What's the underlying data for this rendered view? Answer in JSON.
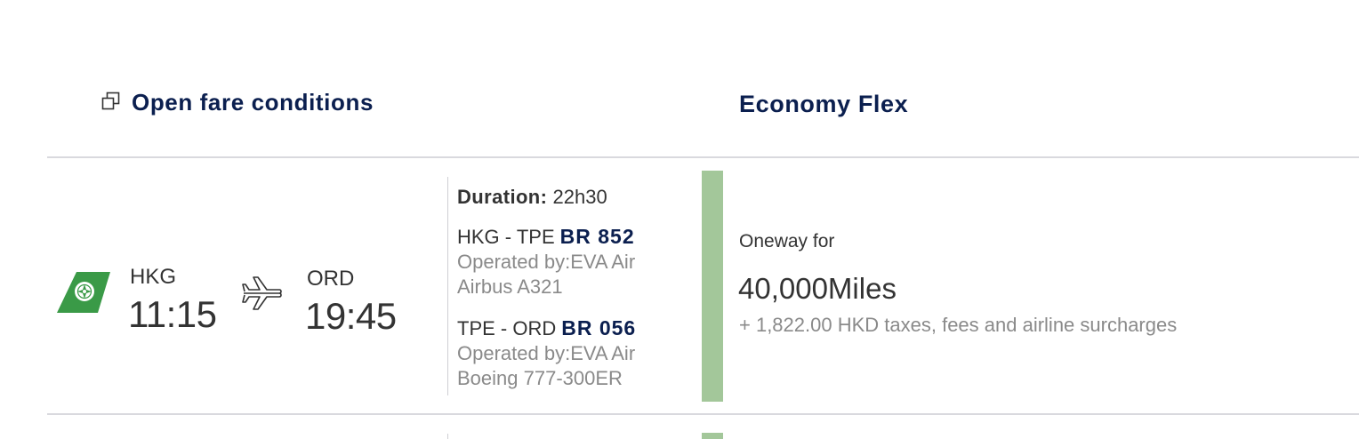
{
  "header": {
    "open_fare_conditions": "Open fare conditions",
    "open_fare_icon": "external-window-icon",
    "fare_title": "Economy Flex"
  },
  "itinerary": {
    "airline_icon": "eva-air-logo",
    "origin": {
      "code": "HKG",
      "time": "11:15"
    },
    "destination": {
      "code": "ORD",
      "time": "19:45"
    },
    "connector_icon": "airplane-icon",
    "duration_label": "Duration:",
    "duration_value": "22h30",
    "segments": [
      {
        "route": "HKG - TPE",
        "flight_number": "BR 852",
        "operated_by": "Operated by:EVA Air",
        "aircraft": "Airbus A321"
      },
      {
        "route": "TPE - ORD",
        "flight_number": "BR 056",
        "operated_by": "Operated by:EVA Air",
        "aircraft": "Boeing 777-300ER"
      }
    ]
  },
  "price": {
    "trip_type": "Oneway for",
    "miles": "40,000Miles",
    "taxes": "+ 1,822.00 HKD taxes, fees and airline surcharges"
  },
  "colors": {
    "navy": "#0b1f4f",
    "fare_bar": "#a3c79a",
    "logo_green": "#3a9a47",
    "divider": "#d9d9de"
  }
}
